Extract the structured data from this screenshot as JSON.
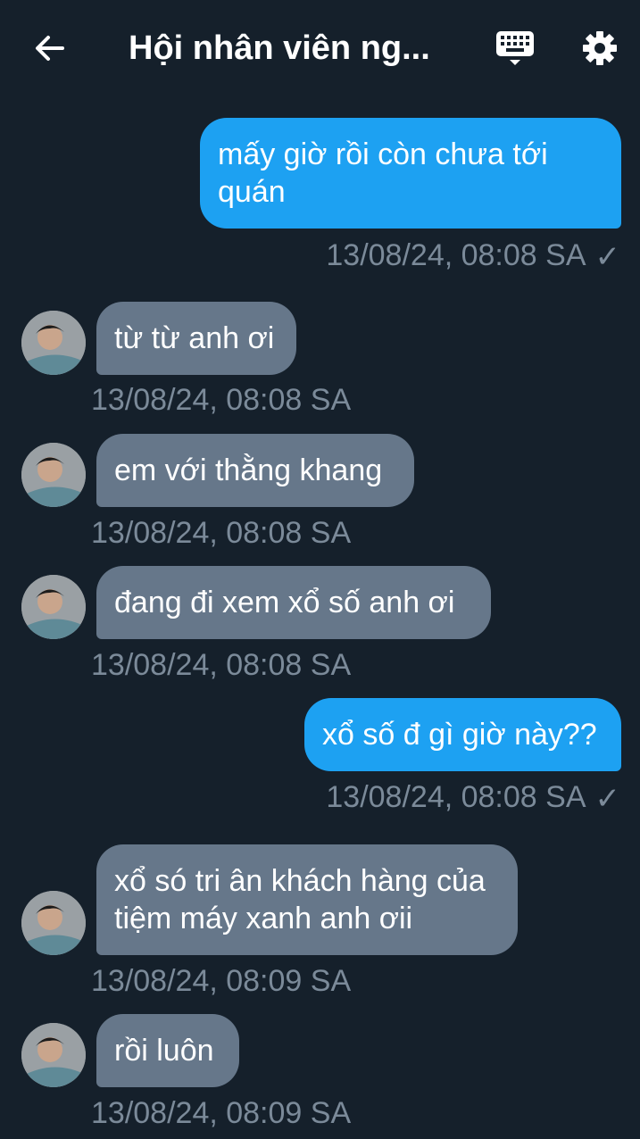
{
  "header": {
    "title": "Hội nhân viên ng...",
    "back_icon": "arrow-left-icon",
    "keyboard_icon": "keyboard-icon",
    "settings_icon": "gear-icon"
  },
  "colors": {
    "background": "#15202b",
    "outgoing_bubble": "#1da1f2",
    "incoming_bubble": "#66778a",
    "timestamp": "#7b8a99"
  },
  "messages": [
    {
      "direction": "out",
      "text": "mấy giờ rồi còn chưa tới quán",
      "time": "13/08/24, 08:08 SA",
      "read": "✓"
    },
    {
      "direction": "in",
      "text": "từ từ anh ơi",
      "time": "13/08/24, 08:08 SA"
    },
    {
      "direction": "in",
      "text": "em với thằng khang",
      "time": "13/08/24, 08:08 SA"
    },
    {
      "direction": "in",
      "text": "đang đi xem xổ số anh ơi",
      "time": "13/08/24, 08:08 SA"
    },
    {
      "direction": "out",
      "text": "xổ số đ gì giờ này??",
      "time": "13/08/24, 08:08 SA",
      "read": "✓"
    },
    {
      "direction": "in",
      "text": "xổ só tri ân khách hàng của tiệm máy xanh anh ơii",
      "time": "13/08/24, 08:09 SA"
    },
    {
      "direction": "in",
      "text": "rồi luôn",
      "time": "13/08/24, 08:09 SA"
    }
  ]
}
